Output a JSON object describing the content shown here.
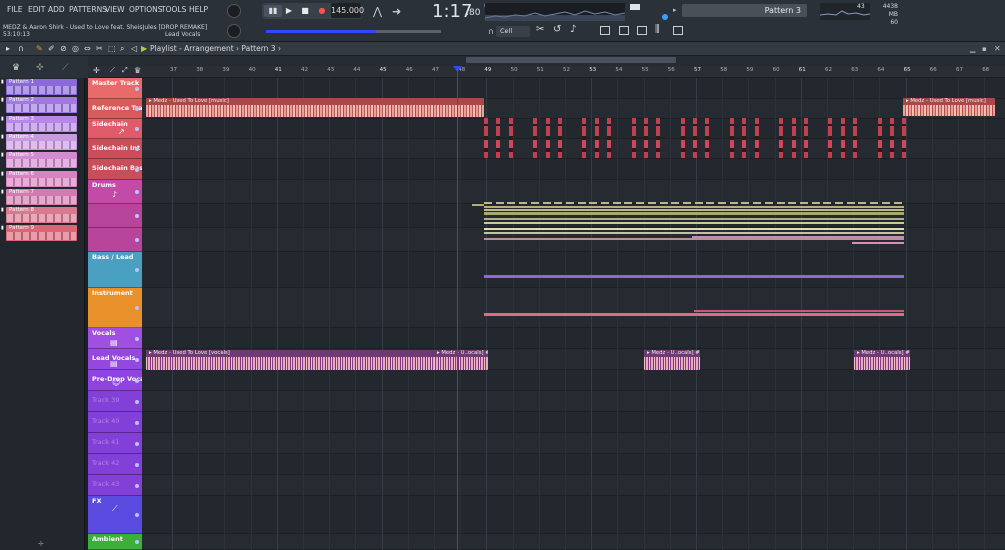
{
  "menu": [
    "FILE",
    "EDIT",
    "ADD",
    "PATTERNS",
    "VIEW",
    "OPTIONS",
    "TOOLS",
    "HELP"
  ],
  "song": {
    "title": "MEDZ & Aaron Shirk - Used to Love feat. SheisJules [DROP REMAKE]",
    "time": "53:10:13",
    "focus": "Lead Vocals"
  },
  "transport": {
    "tempo": "145.000",
    "clock": "1:17",
    "clock_ms": ":80",
    "clock_label": "B:S:T"
  },
  "pattern_select": "Pattern 3",
  "perf": {
    "cpu": "43",
    "mem": "4438 MB",
    "voices": "60"
  },
  "snap": "Cell",
  "playlist": {
    "title": "Playlist - Arrangement",
    "crumb": "Pattern 3",
    "sep": "›"
  },
  "ruler": [
    "37",
    "38",
    "39",
    "40",
    "41",
    "42",
    "43",
    "44",
    "45",
    "46",
    "47",
    "48",
    "49",
    "50",
    "51",
    "52",
    "53",
    "54",
    "55",
    "56",
    "57",
    "58",
    "59",
    "60",
    "61",
    "62",
    "63",
    "64",
    "65",
    "66",
    "67",
    "68"
  ],
  "patterns": [
    "Pattern 1",
    "Pattern 2",
    "Pattern 3",
    "Pattern 4",
    "Pattern 5",
    "Pattern 6",
    "Pattern 7",
    "Pattern 8",
    "Pattern 9"
  ],
  "tracks": [
    "Master Track",
    "Reference Track 2",
    "Sidechain",
    "Sidechain Int",
    "Sidechain Bass",
    "Drums",
    "Bass / Lead",
    "Instrument",
    "Vocals",
    "Lead Vocals",
    "Pre-Drop Vocals",
    "Track 39",
    "Track 40",
    "Track 41",
    "Track 42",
    "Track 43",
    "FX",
    "Ambient"
  ],
  "clips": {
    "ref_a": "▸ Medz - Used To Love [music]",
    "ref_b": "▸ Medz - Used To Love [music]",
    "voc_a": "▸ Medz - Used To Love [vocals]",
    "voc_b": "▸ Medz - U..ocals] #6",
    "voc_c": "▸ Medz - U..ocals] #3",
    "voc_d": "▸ Medz - U..ocals] #3"
  },
  "colors": {
    "accent": "#3049ff",
    "master": "#e86a6a",
    "sidechain": "#e05a6a",
    "drums": "#c44aa8",
    "bass": "#4aa0c0",
    "instrument": "#e8902a",
    "vocals": "#a050e0",
    "fx": "#5a4ae0",
    "ambient": "#3ab03a"
  }
}
